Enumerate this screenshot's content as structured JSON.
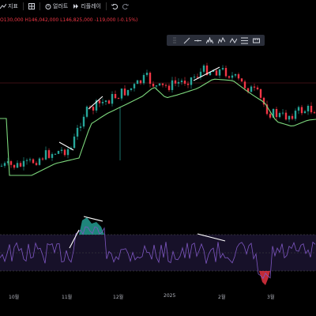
{
  "toolbar": {
    "indicators_label": "지표",
    "alert_label": "얼러트",
    "replay_label": "리플레이"
  },
  "ohlc": {
    "open_text": "O130,000",
    "high_text": "H146,042,000",
    "low_text": "L146,825,000",
    "change_text": "-119,000 (-0.15%)"
  },
  "drawing_tools": [
    "line-tool-icon",
    "horizontal-line-icon",
    "pattern-icon",
    "wave-icon",
    "wave2-icon",
    "measure-icon",
    "text-icon"
  ],
  "x_axis": {
    "labels": [
      "10월",
      "11월",
      "12월",
      "2025",
      "2월",
      "3월"
    ]
  },
  "colors": {
    "up": "#26a69a",
    "down": "#f23645",
    "ma": "#7dd87d",
    "rsi": "#7e57c2",
    "rsi_band": "#2a1f4a"
  }
}
